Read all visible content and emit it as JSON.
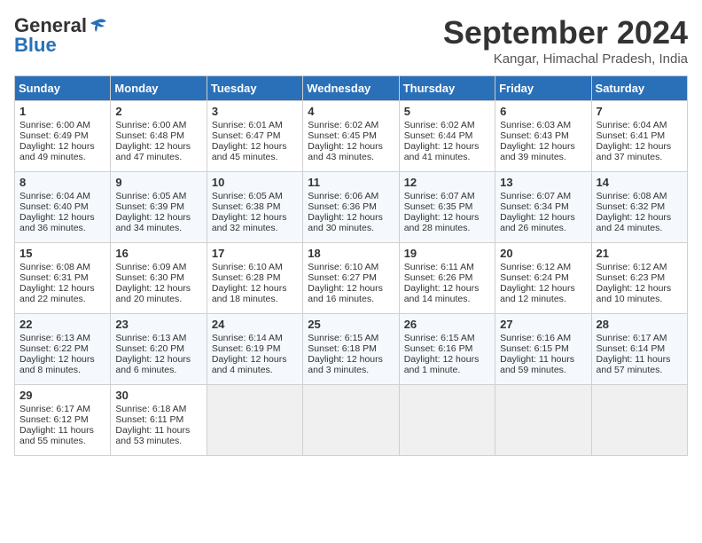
{
  "header": {
    "logo_line1": "General",
    "logo_line2": "Blue",
    "month_title": "September 2024",
    "location": "Kangar, Himachal Pradesh, India"
  },
  "days_of_week": [
    "Sunday",
    "Monday",
    "Tuesday",
    "Wednesday",
    "Thursday",
    "Friday",
    "Saturday"
  ],
  "weeks": [
    [
      {
        "day": "1",
        "lines": [
          "Sunrise: 6:00 AM",
          "Sunset: 6:49 PM",
          "Daylight: 12 hours",
          "and 49 minutes."
        ]
      },
      {
        "day": "2",
        "lines": [
          "Sunrise: 6:00 AM",
          "Sunset: 6:48 PM",
          "Daylight: 12 hours",
          "and 47 minutes."
        ]
      },
      {
        "day": "3",
        "lines": [
          "Sunrise: 6:01 AM",
          "Sunset: 6:47 PM",
          "Daylight: 12 hours",
          "and 45 minutes."
        ]
      },
      {
        "day": "4",
        "lines": [
          "Sunrise: 6:02 AM",
          "Sunset: 6:45 PM",
          "Daylight: 12 hours",
          "and 43 minutes."
        ]
      },
      {
        "day": "5",
        "lines": [
          "Sunrise: 6:02 AM",
          "Sunset: 6:44 PM",
          "Daylight: 12 hours",
          "and 41 minutes."
        ]
      },
      {
        "day": "6",
        "lines": [
          "Sunrise: 6:03 AM",
          "Sunset: 6:43 PM",
          "Daylight: 12 hours",
          "and 39 minutes."
        ]
      },
      {
        "day": "7",
        "lines": [
          "Sunrise: 6:04 AM",
          "Sunset: 6:41 PM",
          "Daylight: 12 hours",
          "and 37 minutes."
        ]
      }
    ],
    [
      {
        "day": "8",
        "lines": [
          "Sunrise: 6:04 AM",
          "Sunset: 6:40 PM",
          "Daylight: 12 hours",
          "and 36 minutes."
        ]
      },
      {
        "day": "9",
        "lines": [
          "Sunrise: 6:05 AM",
          "Sunset: 6:39 PM",
          "Daylight: 12 hours",
          "and 34 minutes."
        ]
      },
      {
        "day": "10",
        "lines": [
          "Sunrise: 6:05 AM",
          "Sunset: 6:38 PM",
          "Daylight: 12 hours",
          "and 32 minutes."
        ]
      },
      {
        "day": "11",
        "lines": [
          "Sunrise: 6:06 AM",
          "Sunset: 6:36 PM",
          "Daylight: 12 hours",
          "and 30 minutes."
        ]
      },
      {
        "day": "12",
        "lines": [
          "Sunrise: 6:07 AM",
          "Sunset: 6:35 PM",
          "Daylight: 12 hours",
          "and 28 minutes."
        ]
      },
      {
        "day": "13",
        "lines": [
          "Sunrise: 6:07 AM",
          "Sunset: 6:34 PM",
          "Daylight: 12 hours",
          "and 26 minutes."
        ]
      },
      {
        "day": "14",
        "lines": [
          "Sunrise: 6:08 AM",
          "Sunset: 6:32 PM",
          "Daylight: 12 hours",
          "and 24 minutes."
        ]
      }
    ],
    [
      {
        "day": "15",
        "lines": [
          "Sunrise: 6:08 AM",
          "Sunset: 6:31 PM",
          "Daylight: 12 hours",
          "and 22 minutes."
        ]
      },
      {
        "day": "16",
        "lines": [
          "Sunrise: 6:09 AM",
          "Sunset: 6:30 PM",
          "Daylight: 12 hours",
          "and 20 minutes."
        ]
      },
      {
        "day": "17",
        "lines": [
          "Sunrise: 6:10 AM",
          "Sunset: 6:28 PM",
          "Daylight: 12 hours",
          "and 18 minutes."
        ]
      },
      {
        "day": "18",
        "lines": [
          "Sunrise: 6:10 AM",
          "Sunset: 6:27 PM",
          "Daylight: 12 hours",
          "and 16 minutes."
        ]
      },
      {
        "day": "19",
        "lines": [
          "Sunrise: 6:11 AM",
          "Sunset: 6:26 PM",
          "Daylight: 12 hours",
          "and 14 minutes."
        ]
      },
      {
        "day": "20",
        "lines": [
          "Sunrise: 6:12 AM",
          "Sunset: 6:24 PM",
          "Daylight: 12 hours",
          "and 12 minutes."
        ]
      },
      {
        "day": "21",
        "lines": [
          "Sunrise: 6:12 AM",
          "Sunset: 6:23 PM",
          "Daylight: 12 hours",
          "and 10 minutes."
        ]
      }
    ],
    [
      {
        "day": "22",
        "lines": [
          "Sunrise: 6:13 AM",
          "Sunset: 6:22 PM",
          "Daylight: 12 hours",
          "and 8 minutes."
        ]
      },
      {
        "day": "23",
        "lines": [
          "Sunrise: 6:13 AM",
          "Sunset: 6:20 PM",
          "Daylight: 12 hours",
          "and 6 minutes."
        ]
      },
      {
        "day": "24",
        "lines": [
          "Sunrise: 6:14 AM",
          "Sunset: 6:19 PM",
          "Daylight: 12 hours",
          "and 4 minutes."
        ]
      },
      {
        "day": "25",
        "lines": [
          "Sunrise: 6:15 AM",
          "Sunset: 6:18 PM",
          "Daylight: 12 hours",
          "and 3 minutes."
        ]
      },
      {
        "day": "26",
        "lines": [
          "Sunrise: 6:15 AM",
          "Sunset: 6:16 PM",
          "Daylight: 12 hours",
          "and 1 minute."
        ]
      },
      {
        "day": "27",
        "lines": [
          "Sunrise: 6:16 AM",
          "Sunset: 6:15 PM",
          "Daylight: 11 hours",
          "and 59 minutes."
        ]
      },
      {
        "day": "28",
        "lines": [
          "Sunrise: 6:17 AM",
          "Sunset: 6:14 PM",
          "Daylight: 11 hours",
          "and 57 minutes."
        ]
      }
    ],
    [
      {
        "day": "29",
        "lines": [
          "Sunrise: 6:17 AM",
          "Sunset: 6:12 PM",
          "Daylight: 11 hours",
          "and 55 minutes."
        ]
      },
      {
        "day": "30",
        "lines": [
          "Sunrise: 6:18 AM",
          "Sunset: 6:11 PM",
          "Daylight: 11 hours",
          "and 53 minutes."
        ]
      },
      {
        "day": "",
        "lines": []
      },
      {
        "day": "",
        "lines": []
      },
      {
        "day": "",
        "lines": []
      },
      {
        "day": "",
        "lines": []
      },
      {
        "day": "",
        "lines": []
      }
    ]
  ]
}
